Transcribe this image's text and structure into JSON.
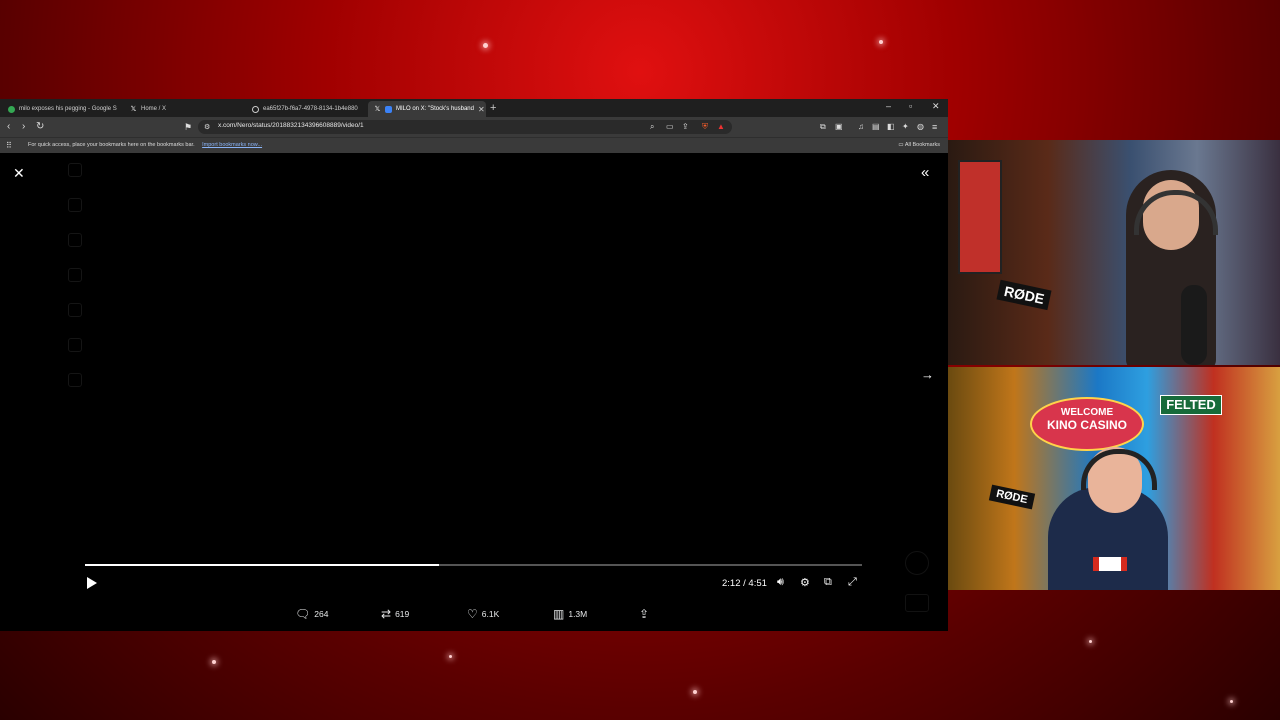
{
  "tabs": [
    {
      "title": "milo exposes his pegging - Google S"
    },
    {
      "title": "Home / X"
    },
    {
      "title": "ea65f27b-f6a7-4978-8134-1b4e880"
    },
    {
      "title": "MILO on X: \"Stock's husband"
    }
  ],
  "address_bar": {
    "url": "x.com/Nero/status/2018832134396608889/video/1"
  },
  "bookmarks_bar": {
    "text": "For quick access, place your bookmarks here on the bookmarks bar.",
    "import_link": "Import bookmarks now...",
    "all_bookmarks": "All Bookmarks"
  },
  "video": {
    "current_time": "2:12",
    "separator": " / ",
    "duration": "4:51",
    "progress_fraction": 0.455
  },
  "actions": {
    "replies": "264",
    "reposts": "619",
    "likes": "6.1K",
    "views": "1.3M"
  },
  "webcams": {
    "cam1_mic_brand": "RØDE",
    "cam2_mic_brand": "RØDE",
    "cam2_sign_line1": "WELCOME",
    "cam2_sign_line2": "KINO CASINO",
    "cam2_street_sign": "FELTED"
  },
  "colors": {
    "background_accent": "#c80a0a",
    "browser_chrome": "#3a3a3a",
    "x_link": "#8ab4f8"
  },
  "icons": {
    "back": "arrow-left",
    "forward": "arrow-right",
    "reload": "reload",
    "close": "x",
    "expand": "double-chevron",
    "next": "arrow-right",
    "play": "play",
    "volume": "speaker",
    "settings": "gear",
    "pip": "picture-in-picture",
    "fullscreen": "fullscreen",
    "reply": "speech-bubble",
    "repost": "retweet",
    "like": "heart",
    "views": "bar-chart",
    "share": "share-upload"
  }
}
